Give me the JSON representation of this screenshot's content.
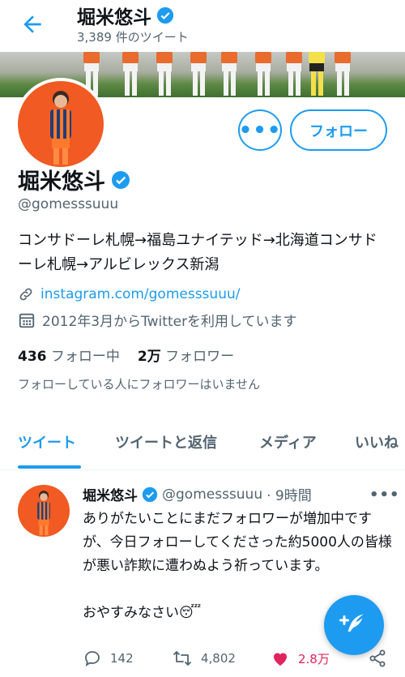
{
  "header": {
    "name": "堀米悠斗",
    "tweet_count": "3,389 件のツイート"
  },
  "profile": {
    "name": "堀米悠斗",
    "handle": "@gomesssuuu",
    "bio": "コンサドーレ札幌→福島ユナイテッド→北海道コンサドーレ札幌→アルビレックス新潟",
    "link": "instagram.com/gomesssuuu/",
    "joined": "2012年3月からTwitterを利用しています",
    "following_count": "436",
    "following_label": "フォロー中",
    "followers_count": "2万",
    "followers_label": "フォロワー",
    "no_mutual": "フォローしている人にフォロワーはいません",
    "more_label": "•••",
    "follow_label": "フォロー"
  },
  "tabs": [
    {
      "label": "ツイート",
      "active": true
    },
    {
      "label": "ツイートと返信",
      "active": false
    },
    {
      "label": "メディア",
      "active": false
    },
    {
      "label": "いいね",
      "active": false
    }
  ],
  "tweet": {
    "name": "堀米悠斗",
    "handle": "@gomesssuuu",
    "time": "· 9時間",
    "text": "ありがたいことにまだフォロワーが増加中ですが、今日フォローしてくださった約5000人の皆様が悪い詐欺に遭わぬよう祈っています。\n\nおやすみなさい😴",
    "more": "•••",
    "replies": "142",
    "retweets": "4,802",
    "likes": "2.8万"
  },
  "colors": {
    "accent": "#1d9bf0",
    "like": "#e0245e",
    "muted": "#536471",
    "avatar_orange": "#f15a22"
  },
  "icons": [
    "back-arrow-icon",
    "verified-badge-icon",
    "link-icon",
    "calendar-icon",
    "reply-icon",
    "retweet-icon",
    "heart-icon",
    "share-icon",
    "compose-feather-icon"
  ]
}
